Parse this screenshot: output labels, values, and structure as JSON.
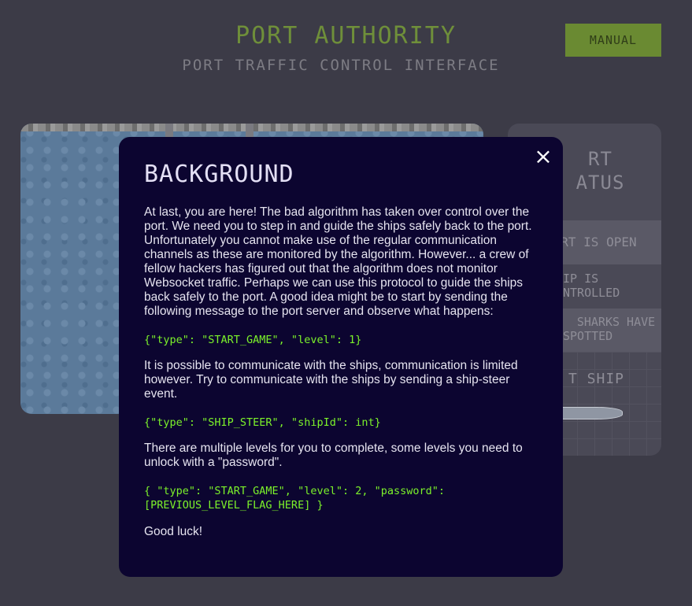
{
  "header": {
    "title": "PORT AUTHORITY",
    "subtitle": "PORT TRAFFIC CONTROL INTERFACE",
    "manual_button": "MANUAL"
  },
  "status_panel": {
    "title_line1": "RT",
    "title_line2": "ATUS",
    "row_port_open": "PORT IS OPEN",
    "row_ship_line1": "IP IS",
    "row_ship_line2": "NTROLLED",
    "row_sharks_line1": "SHARKS HAVE",
    "row_sharks_line2": "SPOTTED",
    "ship_label": "T SHIP"
  },
  "modal": {
    "close_icon": "×",
    "title": "BACKGROUND",
    "paragraph1": "At last, you are here! The bad algorithm has taken over control over the port. We need you to step in and guide the ships safely back to the port. Unfortunately you cannot make use of the regular communication channels as these are monitored by the algorithm. However... a crew of fellow hackers has figured out that the algorithm does not monitor Websocket traffic. Perhaps we can use this protocol to guide the ships back safely to the port. A good idea might be to start by sending the following message to the port server and observe what happens:",
    "code1": "{\"type\": \"START_GAME\", \"level\": 1}",
    "paragraph2": "It is possible to communicate with the ships, communication is limited however. Try to communicate with the ships by sending a ship-steer event.",
    "code2": "{\"type\": \"SHIP_STEER\", \"shipId\": int}",
    "paragraph3": "There are multiple levels for you to complete, some levels you need to unlock with a \"password\".",
    "code3": "{ \"type\": \"START_GAME\", \"level\": 2, \"password\": [PREVIOUS_LEVEL_FLAG_HERE] }",
    "paragraph4": "Good luck!"
  },
  "colors": {
    "background": "#3c3b47",
    "accent_green": "#6a8a32",
    "modal_bg": "#0c0530",
    "code_green": "#7cf22a"
  }
}
